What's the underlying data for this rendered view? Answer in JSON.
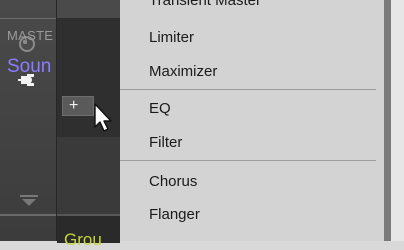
{
  "sidebar": {
    "icons": [
      "knob-icon",
      "plug-icon",
      "collapse-icon"
    ]
  },
  "slot": {
    "master_label": "MASTE",
    "sound_label": "Soun",
    "add_button": "+",
    "group_label": "Grou"
  },
  "menu": {
    "partial_top_item": "Transient Master",
    "items": [
      "Limiter",
      "Maximizer",
      "EQ",
      "Filter",
      "Chorus",
      "Flanger"
    ]
  },
  "colors": {
    "sound_label": "#8a7cff",
    "group_label": "#c6d43a",
    "menu_bg": "#d3d3d3"
  }
}
